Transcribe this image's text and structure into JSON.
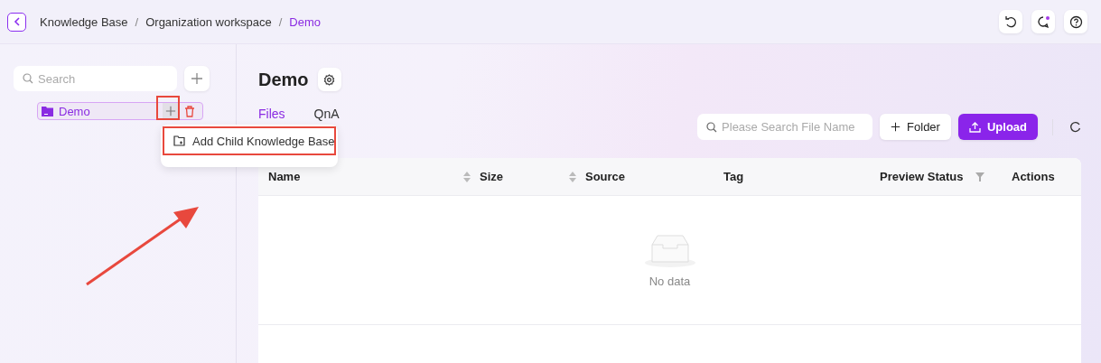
{
  "breadcrumb": [
    {
      "label": "Knowledge Base",
      "selected": false
    },
    {
      "label": "Organization workspace",
      "selected": false
    },
    {
      "label": "Demo",
      "selected": true
    }
  ],
  "breadcrumb_separator": "/",
  "sidebar": {
    "search": {
      "placeholder": "Search"
    },
    "tree": [
      {
        "label": "Demo",
        "selected": true
      }
    ]
  },
  "context_menu": {
    "items": [
      {
        "label": "Add Child Knowledge Base"
      }
    ]
  },
  "page_title": "Demo",
  "tabs": [
    {
      "label": "Files",
      "selected": true
    },
    {
      "label": "QnA",
      "selected": false
    }
  ],
  "file_search": {
    "placeholder": "Please Search File Name"
  },
  "buttons": [
    {
      "kind": "folder",
      "label": "Folder"
    },
    {
      "kind": "upload",
      "label": "Upload"
    }
  ],
  "table": {
    "columns": [
      {
        "label": "Name",
        "kind": "sort"
      },
      {
        "label": "Size",
        "kind": "sort"
      },
      {
        "label": "Source",
        "kind": "plain"
      },
      {
        "label": "Tag",
        "kind": "plain"
      },
      {
        "label": "Preview Status",
        "kind": "filter"
      },
      {
        "label": "Actions",
        "kind": "plain"
      }
    ],
    "empty_text": "No data"
  }
}
